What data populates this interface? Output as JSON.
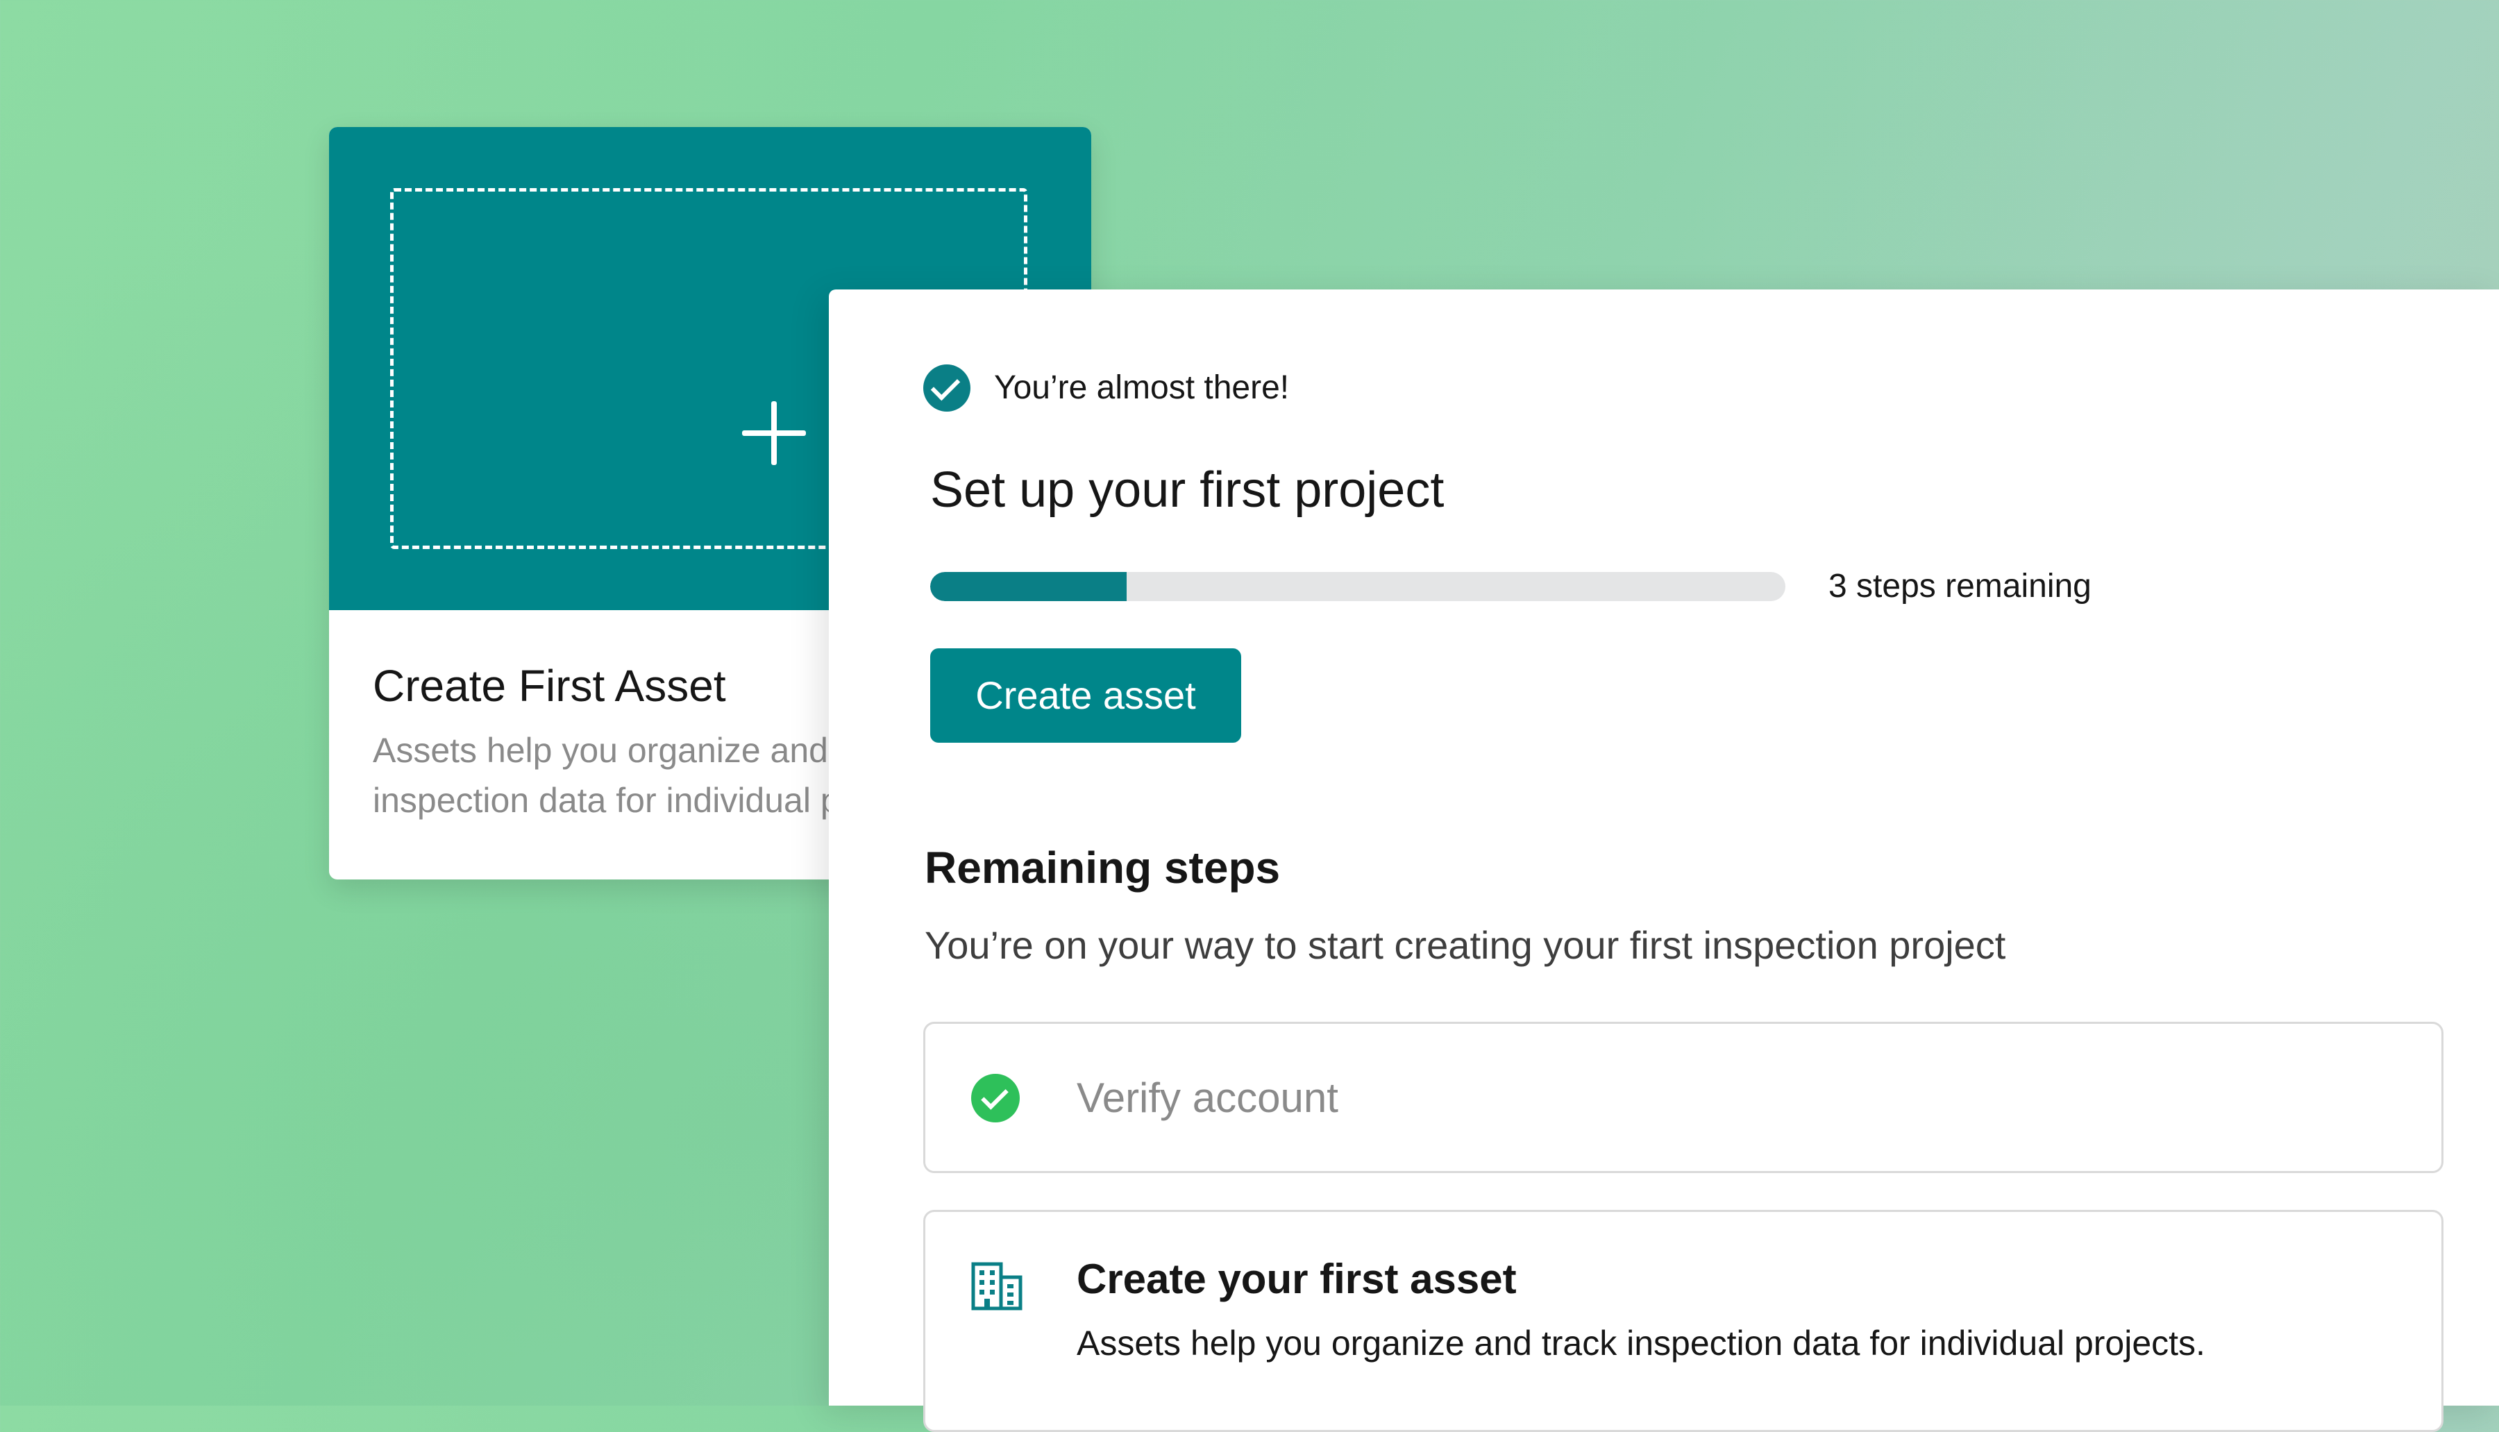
{
  "background_card": {
    "title": "Create First Asset",
    "description": "Assets help you organize and track inspection data for individual projects.",
    "icon": "plus-icon"
  },
  "panel": {
    "status_text": "You’re almost there!",
    "status_icon": "check-circle-icon",
    "title": "Set up your first project",
    "progress": {
      "fraction_complete": 0.23,
      "label": "3 steps remaining"
    },
    "primary_button": "Create asset",
    "remaining": {
      "heading": "Remaining steps",
      "subtitle": "You’re on your way to start creating your first inspection project",
      "steps": [
        {
          "label": "Verify account",
          "status": "complete",
          "icon": "green-check-icon"
        },
        {
          "label": "Create your first asset",
          "description": "Assets help you organize and track inspection data for individual projects.",
          "status": "pending",
          "icon": "building-icon"
        }
      ]
    }
  },
  "colors": {
    "accent": "#00868a",
    "success": "#2ec05a",
    "track": "#e4e5e6"
  }
}
